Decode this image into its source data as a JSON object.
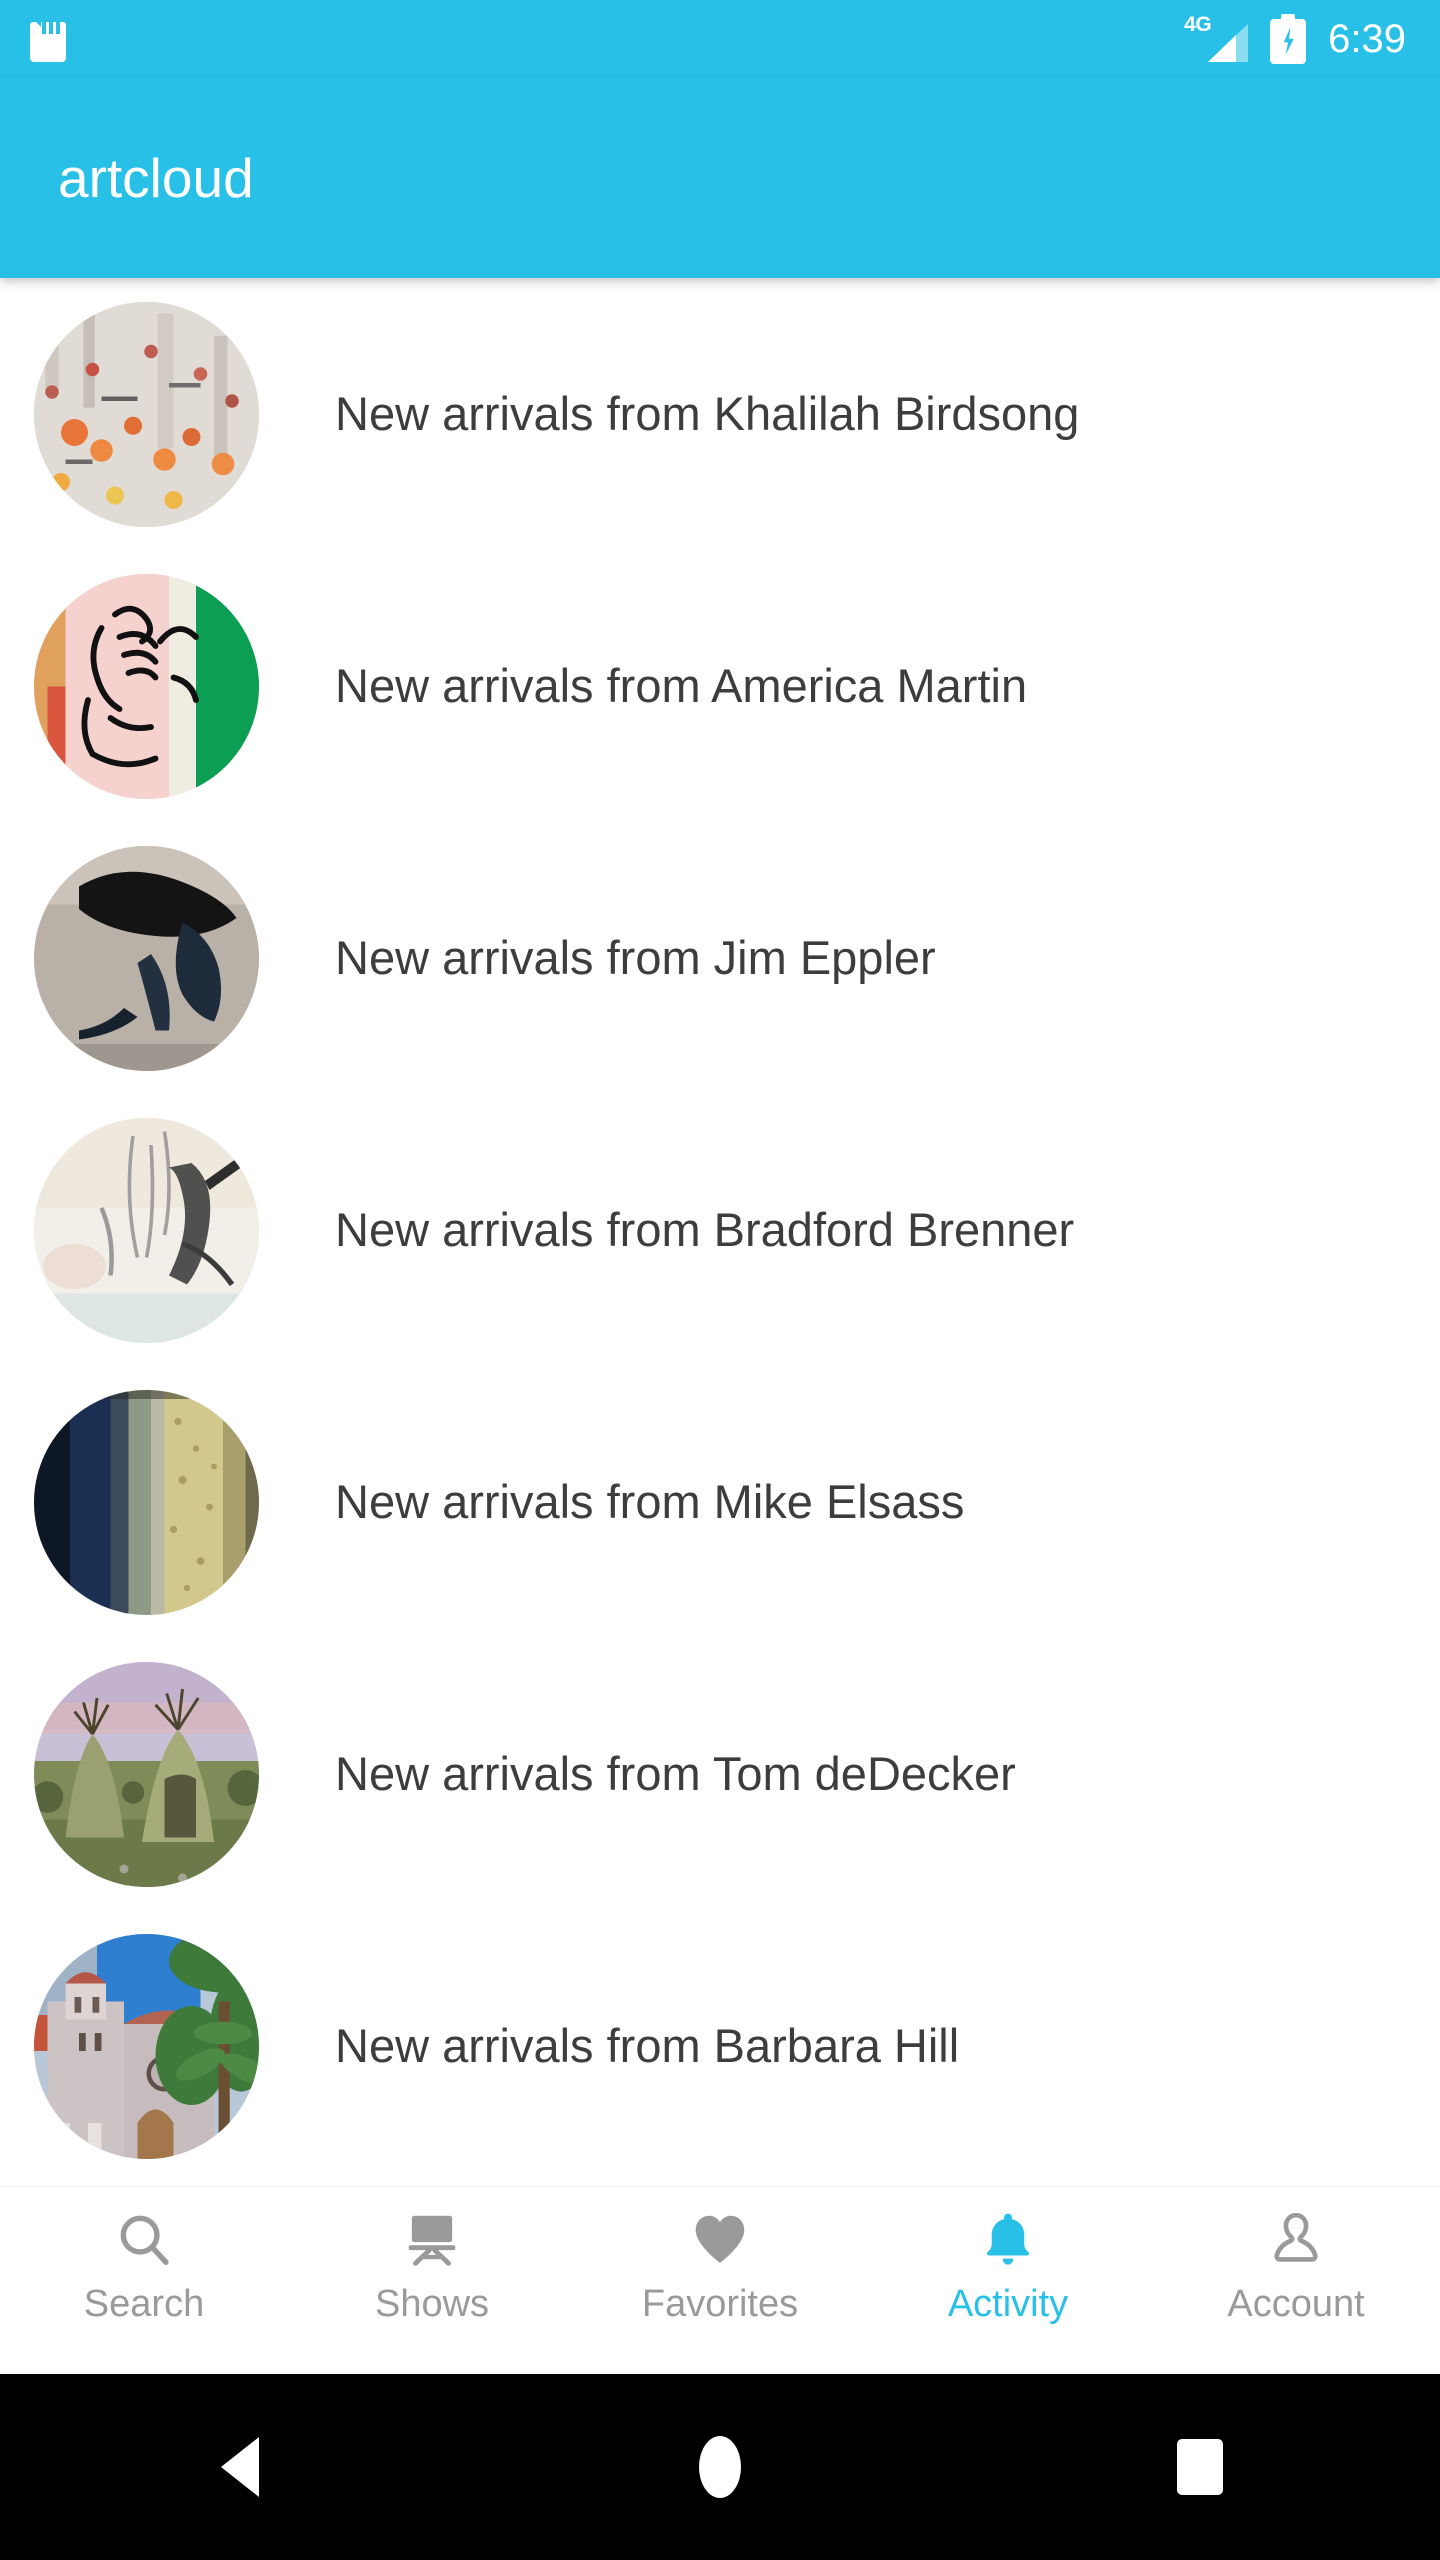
{
  "status_bar": {
    "sd_card_icon": "sd-card-icon",
    "network_label": "4G",
    "signal_icon": "signal-bars-icon",
    "battery_icon": "battery-charging-icon",
    "time": "6:39"
  },
  "app_bar": {
    "title": "artcloud",
    "background_color": "#29c0e8",
    "title_color": "#ffffff"
  },
  "activity_list": {
    "items": [
      {
        "text": "New arrivals from Khalilah Birdsong",
        "artist": "Khalilah Birdsong",
        "avatar": "abstract-speckled-painting"
      },
      {
        "text": "New arrivals from America Martin",
        "artist": "America Martin",
        "avatar": "pink-green-figure-lineart"
      },
      {
        "text": "New arrivals from Jim Eppler",
        "artist": "Jim Eppler",
        "avatar": "black-crow-sculpture"
      },
      {
        "text": "New arrivals from Bradford Brenner",
        "artist": "Bradford Brenner",
        "avatar": "pale-abstract-brushwork"
      },
      {
        "text": "New arrivals from Mike Elsass",
        "artist": "Mike Elsass",
        "avatar": "navy-olive-vertical-stripes"
      },
      {
        "text": "New arrivals from Tom deDecker",
        "artist": "Tom deDecker",
        "avatar": "teepee-landscape-painting"
      },
      {
        "text": "New arrivals from Barbara Hill",
        "artist": "Barbara Hill",
        "avatar": "mission-church-palm-painting"
      }
    ],
    "text_color": "#3d3d3d"
  },
  "bottom_nav": {
    "active_color": "#29c0e8",
    "inactive_color": "#9a9a9a",
    "items": [
      {
        "label": "Search",
        "icon": "search-icon",
        "active": false
      },
      {
        "label": "Shows",
        "icon": "easel-icon",
        "active": false
      },
      {
        "label": "Favorites",
        "icon": "heart-icon",
        "active": false
      },
      {
        "label": "Activity",
        "icon": "bell-icon",
        "active": true
      },
      {
        "label": "Account",
        "icon": "person-icon",
        "active": false
      }
    ]
  },
  "android_nav": {
    "back": "back-triangle-icon",
    "home": "home-circle-icon",
    "recents": "recents-square-icon"
  }
}
